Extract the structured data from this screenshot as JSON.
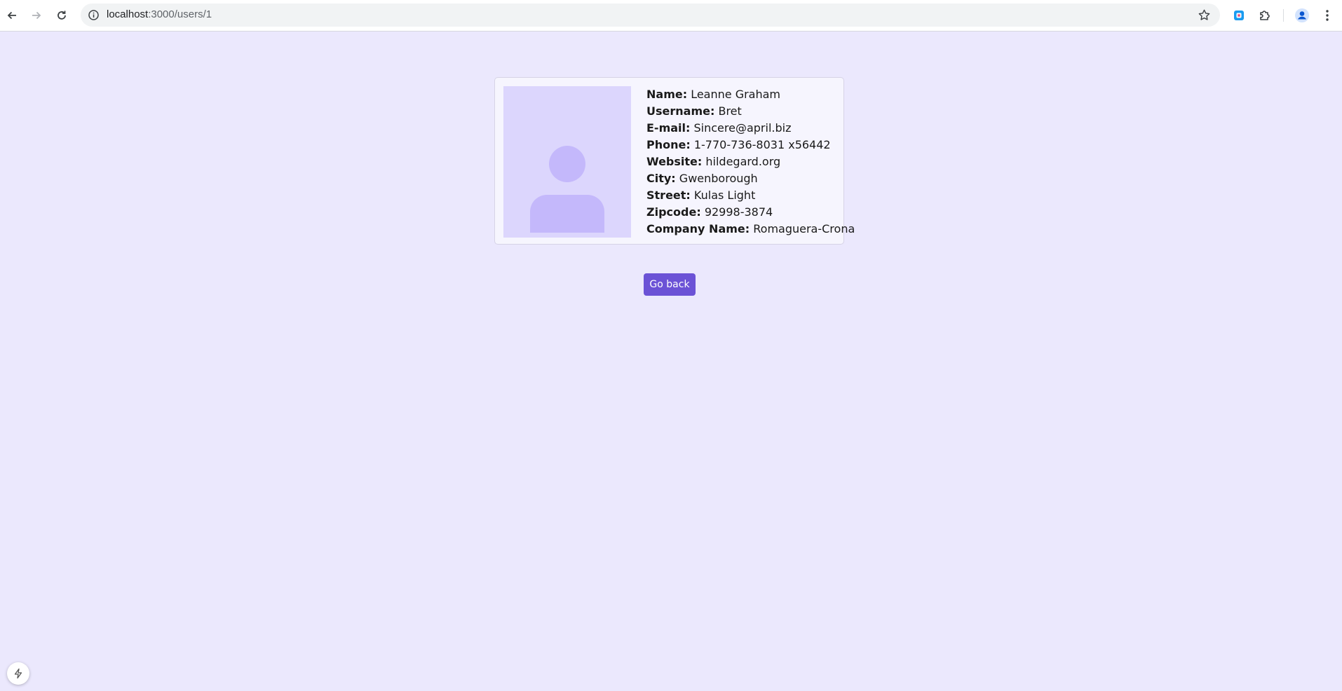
{
  "browser": {
    "url_host": "localhost",
    "url_path": ":3000/users/1",
    "icons": [
      "back-icon",
      "forward-icon",
      "reload-icon",
      "site-info-icon",
      "bookmark-star-icon",
      "extension-icon",
      "puzzle-icon",
      "profile-icon",
      "menu-icon"
    ]
  },
  "user": {
    "fields": [
      {
        "label": "Name:",
        "value": "Leanne Graham"
      },
      {
        "label": "Username:",
        "value": "Bret"
      },
      {
        "label": "E-mail:",
        "value": "Sincere@april.biz"
      },
      {
        "label": "Phone:",
        "value": "1-770-736-8031 x56442"
      },
      {
        "label": "Website:",
        "value": "hildegard.org"
      },
      {
        "label": "City:",
        "value": "Gwenborough"
      },
      {
        "label": "Street:",
        "value": "Kulas Light"
      },
      {
        "label": "Zipcode:",
        "value": "92998-3874"
      },
      {
        "label": "Company Name:",
        "value": "Romaguera-Crona"
      }
    ]
  },
  "actions": {
    "go_back_label": "Go back"
  },
  "colors": {
    "page_bg": "#ebe8fd",
    "accent": "#6b52d6",
    "avatar_bg": "#dcd6fd",
    "avatar_fg": "#c4b8fb"
  }
}
